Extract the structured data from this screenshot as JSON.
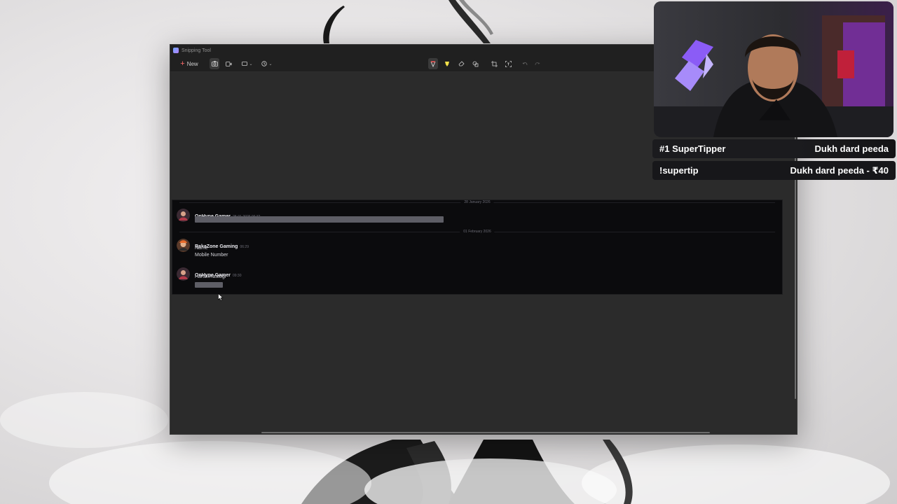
{
  "window": {
    "title": "Snipping Tool"
  },
  "toolbar": {
    "new_label": "New",
    "icons": [
      "camera-icon",
      "video-icon",
      "rectangle-mode-icon",
      "delay-timer-icon",
      "highlighter-pen-icon",
      "highlighter-icon",
      "eraser-icon",
      "shapes-icon",
      "crop-icon",
      "text-actions-icon",
      "undo-icon",
      "redo-icon"
    ]
  },
  "snip": {
    "dividers": [
      "28 January 2026",
      "01 February 2026"
    ],
    "messages": [
      {
        "author": "OnHype Gamer",
        "time": "28-01-2026 06:32",
        "lines": []
      },
      {
        "author": "RakaZone Gaming",
        "time": "06:29",
        "lines": [
          "Name",
          "Mobile Number"
        ]
      },
      {
        "author": "OnHype Gamer",
        "time": "09:30",
        "lines": [
          "Harsh Rastogi"
        ]
      }
    ]
  },
  "overlay": {
    "row1_left": "#1 SuperTipper",
    "row1_right": "Dukh dard peeda",
    "row2_left": "!supertip",
    "row2_right": "Dukh dard peeda - ₹40"
  },
  "colors": {
    "accent_red": "#ff6b6b",
    "snip_bg": "#0b0b0d",
    "window_bg": "#2b2b2b"
  }
}
